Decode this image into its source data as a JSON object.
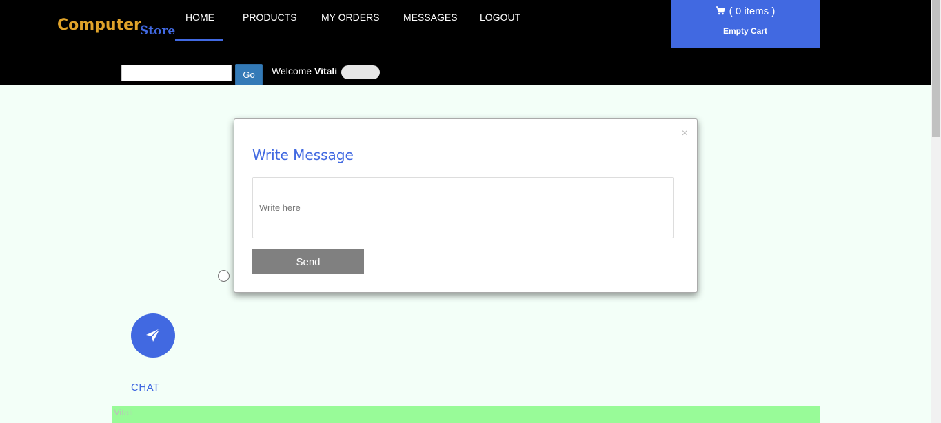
{
  "brand": {
    "part1": "Computer",
    "part2": "Store"
  },
  "nav": {
    "items": [
      {
        "label": "HOME"
      },
      {
        "label": "PRODUCTS"
      },
      {
        "label": "MY ORDERS"
      },
      {
        "label": "MESSAGES"
      },
      {
        "label": "LOGOUT"
      }
    ],
    "active": "HOME"
  },
  "cart": {
    "count_text": "( 0 items )",
    "empty_label": "Empty Cart",
    "icon": "cart-icon"
  },
  "search": {
    "value": "",
    "placeholder": "",
    "button_label": "Go"
  },
  "welcome": {
    "prefix": "Welcome",
    "user": "Vitali"
  },
  "modal": {
    "title": "Write Message",
    "close_glyph": "×",
    "textarea_placeholder": "Write here",
    "send_label": "Send"
  },
  "chat": {
    "label": "CHAT",
    "icon": "paper-plane-icon"
  },
  "footer_bar": {
    "text": "Vitali"
  },
  "colors": {
    "accent": "#4169e1",
    "brand_orange": "#e0a32a",
    "header_bg": "#000000",
    "page_bg": "#f3fff8",
    "send_button": "#808080",
    "green_bar": "#98fb98"
  }
}
